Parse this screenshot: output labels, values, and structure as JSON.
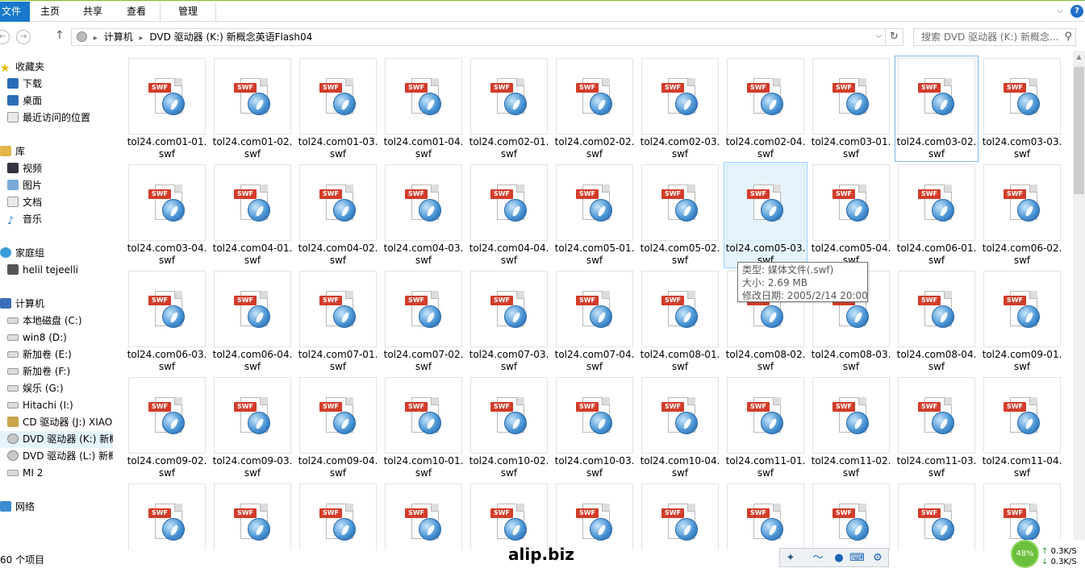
{
  "ribbon": {
    "tabs": {
      "file": "文件",
      "home": "主页",
      "share": "共享",
      "view": "查看",
      "manage": "管理"
    },
    "collapse_icon": "chevron-down-icon",
    "help_icon": "help-icon"
  },
  "address": {
    "back_icon": "back-arrow-icon",
    "forward_icon": "forward-arrow-icon",
    "up_icon": "up-arrow-icon",
    "path": [
      "计算机",
      "DVD 驱动器 (K:) 新概念英语Flash04"
    ],
    "refresh_icon": "refresh-icon",
    "search_placeholder": "搜索 DVD 驱动器 (K:) 新概念..."
  },
  "nav": {
    "items": [
      {
        "label": "收藏夹",
        "icon": "star",
        "indent": 0
      },
      {
        "label": "下载",
        "icon": "fold-blue",
        "indent": 1
      },
      {
        "label": "桌面",
        "icon": "fold-blue",
        "indent": 1
      },
      {
        "label": "最近访问的位置",
        "icon": "doc",
        "indent": 1
      },
      {
        "label": "库",
        "icon": "lib",
        "indent": 0
      },
      {
        "label": "视频",
        "icon": "vid",
        "indent": 1
      },
      {
        "label": "图片",
        "icon": "pic",
        "indent": 1
      },
      {
        "label": "文档",
        "icon": "doc",
        "indent": 1
      },
      {
        "label": "音乐",
        "icon": "mus",
        "indent": 1
      },
      {
        "label": "家庭组",
        "icon": "home",
        "indent": 0
      },
      {
        "label": "helil tejeelli",
        "icon": "user",
        "indent": 1
      },
      {
        "label": "计算机",
        "icon": "pc",
        "indent": 0
      },
      {
        "label": "本地磁盘 (C:)",
        "icon": "drv",
        "indent": 1
      },
      {
        "label": "win8 (D:)",
        "icon": "drv",
        "indent": 1
      },
      {
        "label": "新加卷 (E:)",
        "icon": "drv",
        "indent": 1
      },
      {
        "label": "新加卷 (F:)",
        "icon": "drv",
        "indent": 1
      },
      {
        "label": "娱乐 (G:)",
        "icon": "drv",
        "indent": 1
      },
      {
        "label": "Hitachi (I:)",
        "icon": "drv",
        "indent": 1
      },
      {
        "label": "CD 驱动器 (J:) XIAO",
        "icon": "cd",
        "indent": 1
      },
      {
        "label": "DVD 驱动器 (K:) 新概",
        "icon": "dvd",
        "indent": 1,
        "selected": true
      },
      {
        "label": "DVD 驱动器 (L:) 新概",
        "icon": "dvd",
        "indent": 1
      },
      {
        "label": "MI 2",
        "icon": "drv",
        "indent": 1
      },
      {
        "label": "网络",
        "icon": "net",
        "indent": 0
      }
    ]
  },
  "files": {
    "badge": "SWF",
    "ext": "swf",
    "names": [
      "tol24.com01-01.",
      "tol24.com01-02.",
      "tol24.com01-03.",
      "tol24.com01-04.",
      "tol24.com02-01.",
      "tol24.com02-02.",
      "tol24.com02-03.",
      "tol24.com02-04.",
      "tol24.com03-01.",
      "tol24.com03-02.",
      "tol24.com03-03.",
      "tol24.com03-04.",
      "tol24.com04-01.",
      "tol24.com04-02.",
      "tol24.com04-03.",
      "tol24.com04-04.",
      "tol24.com05-01.",
      "tol24.com05-02.",
      "tol24.com05-03.",
      "tol24.com05-04.",
      "tol24.com06-01.",
      "tol24.com06-02.",
      "tol24.com06-03.",
      "tol24.com06-04.",
      "tol24.com07-01.",
      "tol24.com07-02.",
      "tol24.com07-03.",
      "tol24.com07-04.",
      "tol24.com08-01.",
      "tol24.com08-02.",
      "tol24.com08-03.",
      "tol24.com08-04.",
      "tol24.com09-01.",
      "tol24.com09-02.",
      "tol24.com09-03.",
      "tol24.com09-04.",
      "tol24.com10-01.",
      "tol24.com10-02.",
      "tol24.com10-03.",
      "tol24.com10-04.",
      "tol24.com11-01.",
      "tol24.com11-02.",
      "tol24.com11-03.",
      "tol24.com11-04.",
      "",
      "",
      "",
      "",
      "",
      "",
      "",
      "",
      "",
      "",
      ""
    ],
    "hovered_index": 9,
    "selected_index": 18
  },
  "tooltip": {
    "type": "类型: 媒体文件(.swf)",
    "size": "大小: 2.69 MB",
    "modified": "修改日期: 2005/2/14 20:00"
  },
  "status": {
    "item_count": "60 个项目",
    "watermark": "alip.biz",
    "tray_icons": [
      "bird-icon",
      "input-method-icon",
      "user-icon",
      "keyboard-icon",
      "gear-icon"
    ],
    "net_percent": "48%",
    "upload": "0.3K/S",
    "download": "0.3K/S"
  }
}
